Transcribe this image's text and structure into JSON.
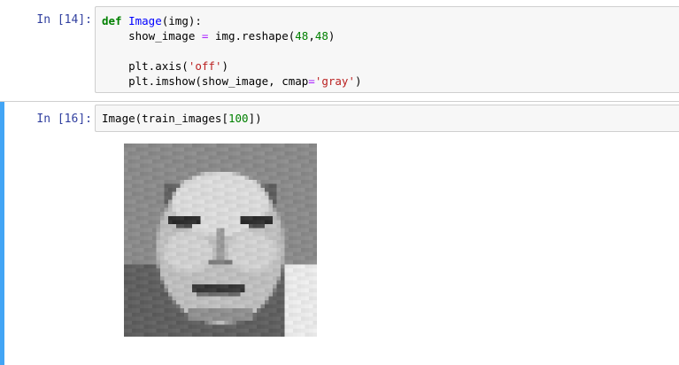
{
  "cells": [
    {
      "prompt": "In [14]:",
      "code_lines": [
        [
          {
            "t": "def",
            "c": "kw"
          },
          {
            "t": " ",
            "c": ""
          },
          {
            "t": "Image",
            "c": "fn"
          },
          {
            "t": "(img):",
            "c": ""
          }
        ],
        [
          {
            "t": "    show_image ",
            "c": ""
          },
          {
            "t": "=",
            "c": "op"
          },
          {
            "t": " img.reshape(",
            "c": ""
          },
          {
            "t": "48",
            "c": "num"
          },
          {
            "t": ",",
            "c": ""
          },
          {
            "t": "48",
            "c": "num"
          },
          {
            "t": ")",
            "c": ""
          }
        ],
        [],
        [
          {
            "t": "    plt.axis(",
            "c": ""
          },
          {
            "t": "'off'",
            "c": "str"
          },
          {
            "t": ")",
            "c": ""
          }
        ],
        [
          {
            "t": "    plt.imshow(show_image, cmap",
            "c": ""
          },
          {
            "t": "=",
            "c": "op"
          },
          {
            "t": "'gray'",
            "c": "str"
          },
          {
            "t": ")",
            "c": ""
          }
        ]
      ]
    },
    {
      "prompt": "In [16]:",
      "code_lines": [
        [
          {
            "t": "Image(train_images[",
            "c": ""
          },
          {
            "t": "100",
            "c": "num"
          },
          {
            "t": "])",
            "c": ""
          }
        ]
      ],
      "output": {
        "type": "image",
        "description": "48x48 grayscale face image",
        "cmap": "gray"
      }
    }
  ],
  "theme": {
    "prompt_color": "#303f9f",
    "selected_bar_color": "#42a5f5",
    "input_bg": "#f7f7f7",
    "input_border": "#cfcfcf"
  }
}
